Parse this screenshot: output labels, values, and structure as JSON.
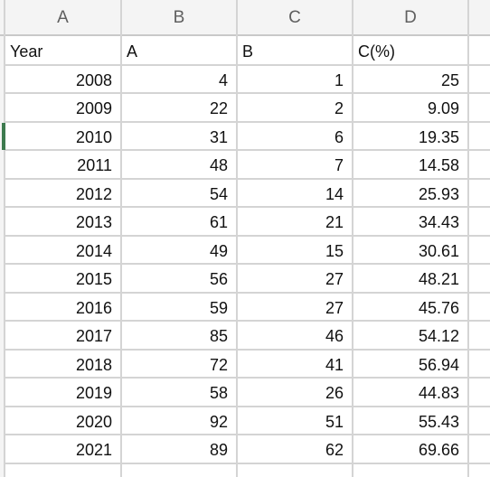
{
  "spreadsheet": {
    "column_letters": [
      "A",
      "B",
      "C",
      "D"
    ],
    "header_row": [
      "Year",
      "A",
      "B",
      "C(%)"
    ],
    "rows": [
      [
        "2008",
        "4",
        "1",
        "25"
      ],
      [
        "2009",
        "22",
        "2",
        "9.09"
      ],
      [
        "2010",
        "31",
        "6",
        "19.35"
      ],
      [
        "2011",
        "48",
        "7",
        "14.58"
      ],
      [
        "2012",
        "54",
        "14",
        "25.93"
      ],
      [
        "2013",
        "61",
        "21",
        "34.43"
      ],
      [
        "2014",
        "49",
        "15",
        "30.61"
      ],
      [
        "2015",
        "56",
        "27",
        "48.21"
      ],
      [
        "2016",
        "59",
        "27",
        "45.76"
      ],
      [
        "2017",
        "85",
        "46",
        "54.12"
      ],
      [
        "2018",
        "72",
        "41",
        "56.94"
      ],
      [
        "2019",
        "58",
        "26",
        "44.83"
      ],
      [
        "2020",
        "92",
        "51",
        "55.43"
      ],
      [
        "2021",
        "89",
        "62",
        "69.66"
      ]
    ],
    "active_row_year": "2010",
    "active_marker_color": "#3d7a4e"
  }
}
